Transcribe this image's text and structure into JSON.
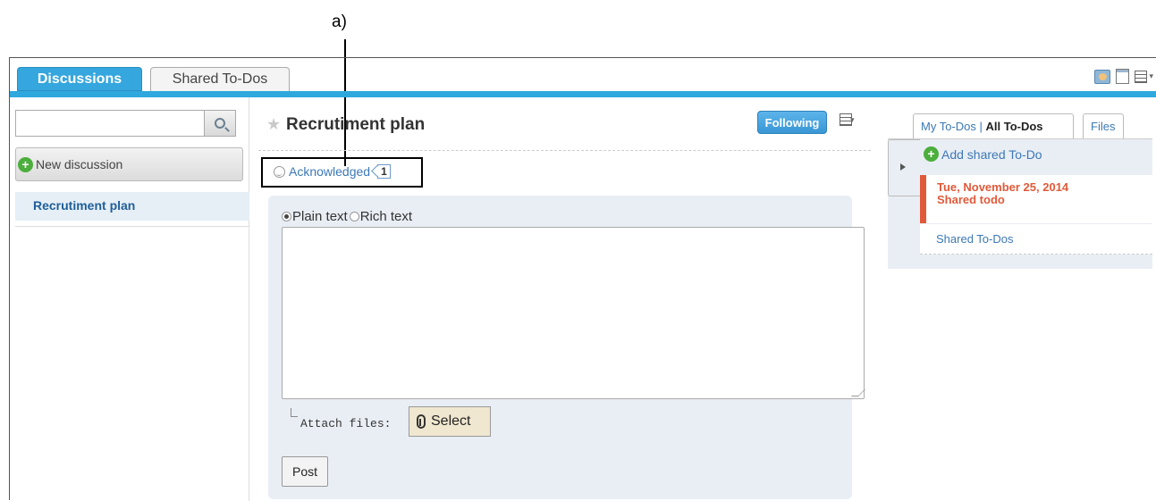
{
  "annotation": {
    "label": "a)"
  },
  "tabs": {
    "active": "Discussions",
    "inactive": "Shared To-Dos"
  },
  "sidebar": {
    "search_placeholder": "",
    "new_discussion": "New discussion",
    "items": [
      {
        "label": "Recrutiment plan"
      }
    ]
  },
  "main": {
    "title": "Recrutiment plan",
    "following": "Following",
    "acknowledged": "Acknowledged",
    "ack_count": "1",
    "format": {
      "plain": "Plain text",
      "rich": "Rich text",
      "selected": "plain"
    },
    "attach_label": "Attach files:",
    "select_label": "Select",
    "post_label": "Post"
  },
  "right": {
    "tab_my": "My To-Dos",
    "tab_sep": " | ",
    "tab_all": "All To-Dos",
    "tab_files": "Files",
    "add_shared": "Add shared To-Do",
    "todo_date": "Tue, November 25, 2014",
    "todo_title": "Shared todo",
    "shared_link": "Shared To-Dos"
  },
  "colors": {
    "accent": "#2fa8dd",
    "todo_due": "#e05a3a",
    "link": "#3c78b5"
  }
}
